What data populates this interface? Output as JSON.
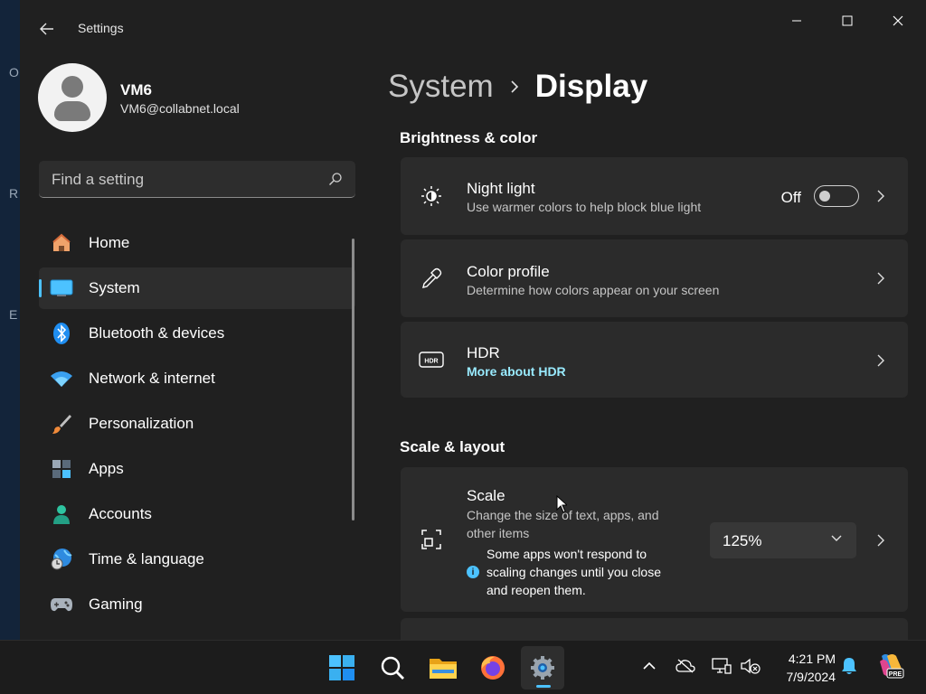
{
  "window": {
    "app_title": "Settings",
    "back_icon": "arrow-left-icon",
    "controls": [
      "minimize-icon",
      "maximize-icon",
      "close-icon"
    ]
  },
  "profile": {
    "name": "VM6",
    "email": "VM6@collabnet.local"
  },
  "search": {
    "placeholder": "Find a setting",
    "icon": "search-icon"
  },
  "nav": {
    "items": [
      {
        "label": "Home",
        "icon": "home-icon",
        "active": false
      },
      {
        "label": "System",
        "icon": "display-icon",
        "active": true
      },
      {
        "label": "Bluetooth & devices",
        "icon": "bluetooth-icon",
        "active": false
      },
      {
        "label": "Network & internet",
        "icon": "wifi-icon",
        "active": false
      },
      {
        "label": "Personalization",
        "icon": "brush-icon",
        "active": false
      },
      {
        "label": "Apps",
        "icon": "apps-icon",
        "active": false
      },
      {
        "label": "Accounts",
        "icon": "person-icon",
        "active": false
      },
      {
        "label": "Time & language",
        "icon": "globe-clock-icon",
        "active": false
      },
      {
        "label": "Gaming",
        "icon": "controller-icon",
        "active": false
      }
    ]
  },
  "breadcrumb": {
    "parent": "System",
    "current": "Display"
  },
  "sections": {
    "brightness": "Brightness & color",
    "scale_layout": "Scale & layout"
  },
  "night_light": {
    "title": "Night light",
    "subtitle": "Use warmer colors to help block blue light",
    "state_label": "Off",
    "enabled": false
  },
  "color_profile": {
    "title": "Color profile",
    "subtitle": "Determine how colors appear on your screen"
  },
  "hdr": {
    "title": "HDR",
    "link": "More about HDR"
  },
  "scale": {
    "title": "Scale",
    "subtitle": "Change the size of text, apps, and other items",
    "value": "125%",
    "info": "Some apps won't respond to scaling changes until you close and reopen them."
  },
  "taskbar": {
    "apps": [
      "windows-start-icon",
      "search-icon",
      "file-explorer-icon",
      "firefox-icon",
      "settings-gear-icon"
    ],
    "active_app": "settings-gear-icon",
    "tray": [
      "chevron-up-icon",
      "onedrive-offline-icon",
      "network-icon",
      "volume-muted-icon",
      "notification-bell-icon",
      "copilot-icon"
    ],
    "time": "4:21 PM",
    "date": "7/9/2024"
  },
  "colors": {
    "background": "#202020",
    "card": "#2b2b2b",
    "accent": "#4cc2ff",
    "link": "#99ebff"
  }
}
